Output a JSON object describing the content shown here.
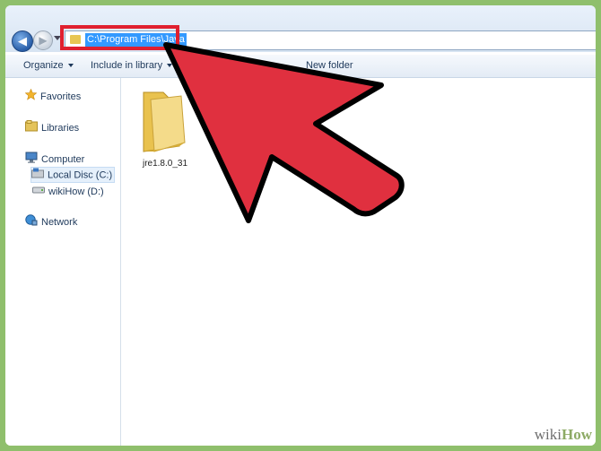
{
  "address": {
    "path": "C:\\Program Files\\Java"
  },
  "toolbar": {
    "organize_label": "Organize",
    "include_label": "Include in library",
    "new_folder_label": "New folder"
  },
  "navpane": {
    "favorites": "Favorites",
    "libraries": "Libraries",
    "computer": "Computer",
    "local_disc": "Local Disc (C:)",
    "wikihow_drive": "wikiHow (D:)",
    "network": "Network"
  },
  "content": {
    "folders": [
      {
        "name": "jre1.8.0_31"
      }
    ]
  },
  "watermark": {
    "part1": "wiki",
    "part2": "How"
  },
  "colors": {
    "background": "#8fbf6c",
    "highlight": "#e0202f",
    "arrow_fill": "#e0303f",
    "selection": "#3399ff"
  }
}
